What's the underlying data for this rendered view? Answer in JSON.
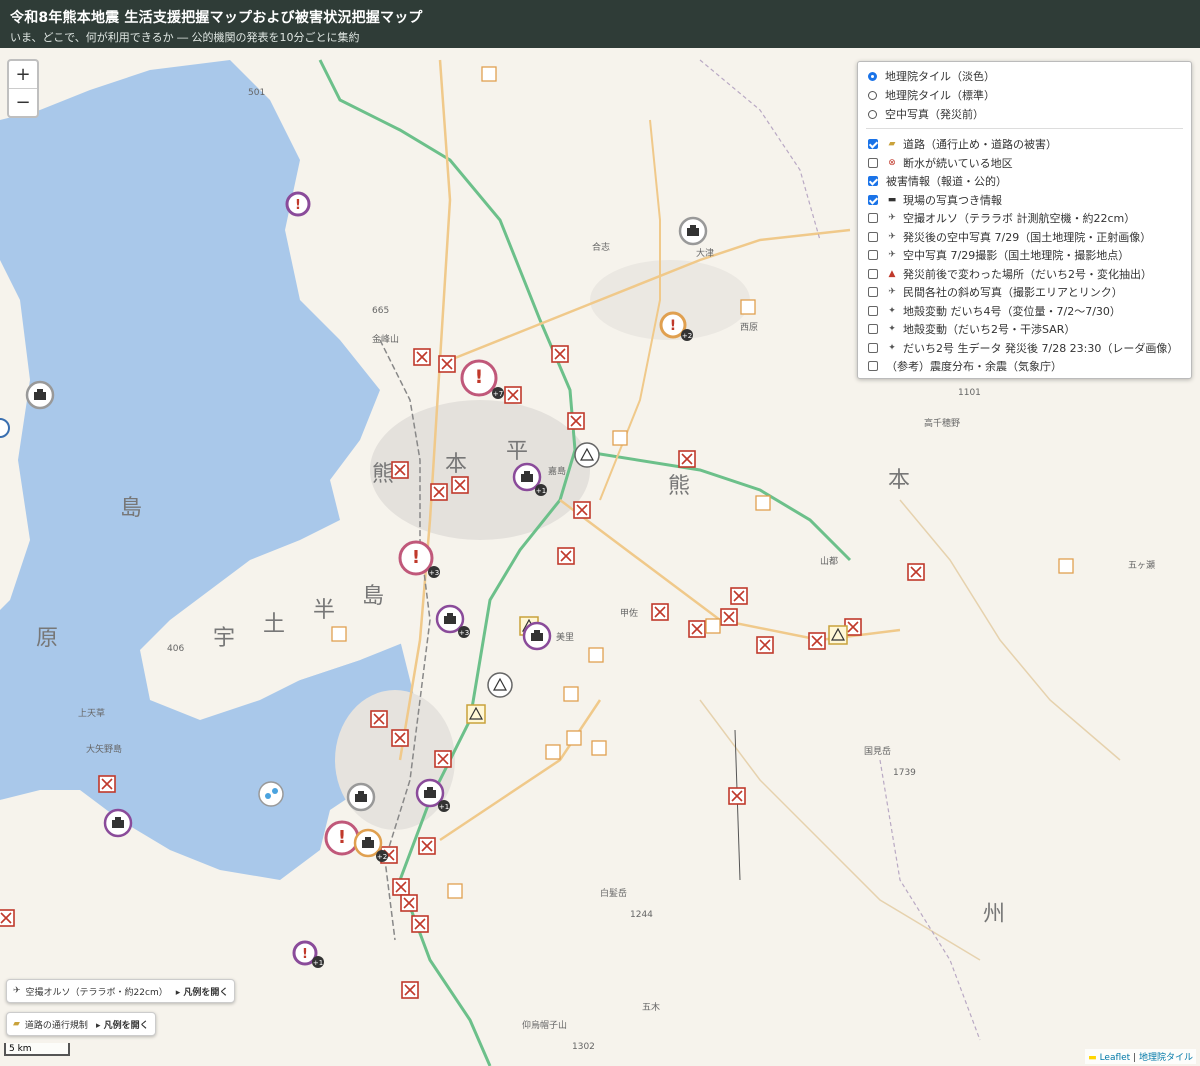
{
  "header": {
    "title": "令和8年熊本地震 生活支援把握マップおよび被害状況把握マップ",
    "subtitle": "いま、どこで、何が利用できるか ― 公的機関の発表を10分ごとに集約"
  },
  "zoom": {
    "in_label": "+",
    "out_label": "−"
  },
  "base_layers": [
    {
      "label": "地理院タイル（淡色）",
      "selected": true
    },
    {
      "label": "地理院タイル（標準）",
      "selected": false
    },
    {
      "label": "空中写真（発災前）",
      "selected": false
    }
  ],
  "overlays": [
    {
      "label": "道路（通行止め・道路の被害）",
      "checked": true,
      "icon": "road-barrier-icon",
      "symbol": "▰"
    },
    {
      "label": "断水が続いている地区",
      "checked": false,
      "icon": "water-cut-icon",
      "symbol": "⊗"
    },
    {
      "label": "被害情報（報道・公的）",
      "checked": true,
      "icon": "",
      "symbol": ""
    },
    {
      "label": "現場の写真つき情報",
      "checked": true,
      "icon": "camera-icon",
      "symbol": "▬"
    },
    {
      "label": "空撮オルソ（テララボ 計測航空機・約22cm）",
      "checked": false,
      "icon": "plane-icon",
      "symbol": "✈"
    },
    {
      "label": "発災後の空中写真 7/29（国土地理院・正射画像）",
      "checked": false,
      "icon": "plane-icon",
      "symbol": "✈"
    },
    {
      "label": "空中写真 7/29撮影（国土地理院・撮影地点）",
      "checked": false,
      "icon": "plane-icon",
      "symbol": "✈"
    },
    {
      "label": "発災前後で変わった場所（だいち2号・変化抽出）",
      "checked": false,
      "icon": "triangle-icon",
      "symbol": "▲"
    },
    {
      "label": "民間各社の斜め写真（撮影エリアとリンク）",
      "checked": false,
      "icon": "plane-icon",
      "symbol": "✈"
    },
    {
      "label": "地殻変動 だいち4号（変位量・7/2〜7/30）",
      "checked": false,
      "icon": "satellite-icon",
      "symbol": "✦"
    },
    {
      "label": "地殻変動（だいち2号・干渉SAR）",
      "checked": false,
      "icon": "satellite-icon",
      "symbol": "✦"
    },
    {
      "label": "だいち2号 生データ 発災後 7/28 23:30（レーダ画像）",
      "checked": false,
      "icon": "satellite-icon",
      "symbol": "✦"
    },
    {
      "label": "（参考）震度分布・余震（気象庁）",
      "checked": false,
      "icon": "",
      "symbol": ""
    }
  ],
  "legend_buttons": [
    {
      "label": "空撮オルソ（テララボ・約22cm）",
      "open": "▸ 凡例を開く",
      "symbol": "✈"
    },
    {
      "label": "道路の通行規制",
      "open": "▸ 凡例を開く",
      "symbol": "▰"
    }
  ],
  "scale": "5 km",
  "attribution": {
    "leaflet": "Leaflet",
    "sep": " | ",
    "tiles": "地理院タイル"
  },
  "places": {
    "kumamoto1": "熊",
    "kumamoto2": "本",
    "hira": "平",
    "kuma2": "熊",
    "hon2": "本",
    "shima": "島",
    "uto": "宇",
    "tsuchi": "土",
    "han": "半",
    "shima2": "島",
    "gen": "原",
    "shu": "州",
    "takakura": "高千穂野",
    "kunimi": "国見岳",
    "shiragane": "白髪岳",
    "gokase": "五木",
    "kamiamakusa": "上天草",
    "oyano": "大矢野島",
    "kashima": "嘉島",
    "kosa": "甲佐",
    "misato": "美里",
    "yamato": "山都",
    "goko": "五ヶ瀬",
    "nishihara": "西原",
    "ozu": "大津",
    "kikuchi": "合志",
    "kinpo": "金峰山",
    "gonoura": "仰烏帽子山",
    "h1101": "1101",
    "h1739": "1739",
    "h1244": "1244",
    "h1302": "1302",
    "h406": "406",
    "h501": "501",
    "h665": "665"
  },
  "marker_badges": {
    "b1": "+7",
    "b2": "+1",
    "b3": "+3",
    "b4": "+3",
    "b5": "+2",
    "b6": "+1",
    "b7": "+2",
    "b8": "+1"
  }
}
